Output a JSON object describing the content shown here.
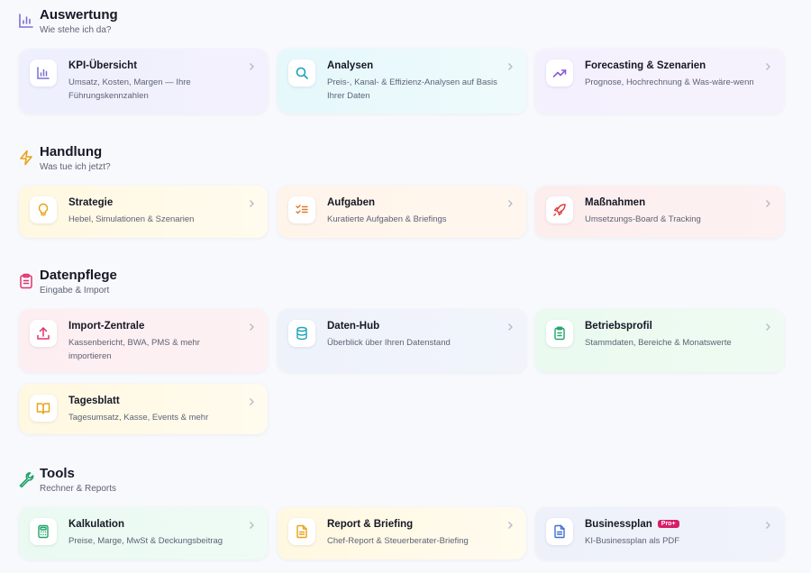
{
  "sections": {
    "auswertung": {
      "title": "Auswertung",
      "subtitle": "Wie stehe ich da?",
      "cards": [
        {
          "title": "KPI-Übersicht",
          "desc": "Umsatz, Kosten, Margen — Ihre Führungskennzahlen"
        },
        {
          "title": "Analysen",
          "desc": "Preis-, Kanal- & Effizienz-Analysen auf Basis Ihrer Daten"
        },
        {
          "title": "Forecasting & Szenarien",
          "desc": "Prognose, Hochrechnung & Was-wäre-wenn"
        }
      ]
    },
    "handlung": {
      "title": "Handlung",
      "subtitle": "Was tue ich jetzt?",
      "cards": [
        {
          "title": "Strategie",
          "desc": "Hebel, Simulationen & Szenarien"
        },
        {
          "title": "Aufgaben",
          "desc": "Kuratierte Aufgaben & Briefings"
        },
        {
          "title": "Maßnahmen",
          "desc": "Umsetzungs-Board & Tracking"
        }
      ]
    },
    "datenpflege": {
      "title": "Datenpflege",
      "subtitle": "Eingabe & Import",
      "cards": [
        {
          "title": "Import-Zentrale",
          "desc": "Kassenbericht, BWA, PMS & mehr importieren"
        },
        {
          "title": "Daten-Hub",
          "desc": "Überblick über Ihren Datenstand"
        },
        {
          "title": "Betriebsprofil",
          "desc": "Stammdaten, Bereiche & Monatswerte"
        },
        {
          "title": "Tagesblatt",
          "desc": "Tagesumsatz, Kasse, Events & mehr"
        }
      ]
    },
    "tools": {
      "title": "Tools",
      "subtitle": "Rechner & Reports",
      "cards": [
        {
          "title": "Kalkulation",
          "desc": "Preise, Marge, MwSt & Deckungsbeitrag"
        },
        {
          "title": "Report & Briefing",
          "desc": "Chef-Report & Steuerberater-Briefing"
        },
        {
          "title": "Businessplan",
          "desc": "KI-Businessplan als PDF",
          "badge": "Pro+"
        }
      ]
    }
  },
  "colors": {
    "auswertung_accent": "#7c6fd6",
    "handlung_accent": "#e8a317",
    "datenpflege_accent": "#e0336b",
    "tools_accent": "#22a36a",
    "badge": "#d61f69"
  },
  "icons": {
    "auswertung": "bar-chart-icon",
    "handlung": "lightning-icon",
    "datenpflege": "clipboard-icon",
    "tools": "wrench-icon"
  }
}
